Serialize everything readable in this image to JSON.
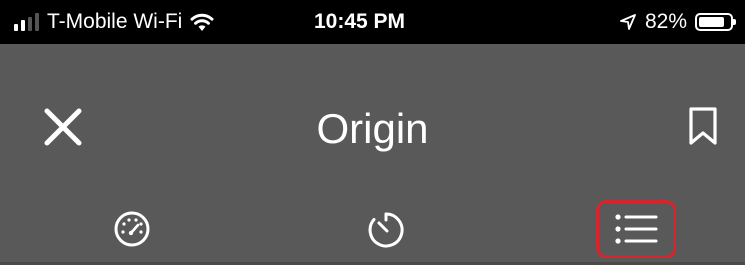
{
  "status_bar": {
    "carrier": "T-Mobile Wi-Fi",
    "time": "10:45 PM",
    "battery_percent": "82%",
    "battery_level": 0.82,
    "signal_bars_active": 2,
    "signal_bars_total": 4,
    "wifi_icon": "wifi-icon",
    "location_icon": "location-arrow-icon"
  },
  "header": {
    "title": "Origin",
    "close_icon": "close-icon",
    "bookmark_icon": "bookmark-icon"
  },
  "tabs": [
    {
      "icon": "speedometer-icon",
      "selected": false
    },
    {
      "icon": "timer-icon",
      "selected": false
    },
    {
      "icon": "list-icon",
      "selected": true
    }
  ],
  "colors": {
    "background": "#595959",
    "status_bar": "#000000",
    "selected_highlight": "#d6262d",
    "foreground": "#ffffff"
  }
}
